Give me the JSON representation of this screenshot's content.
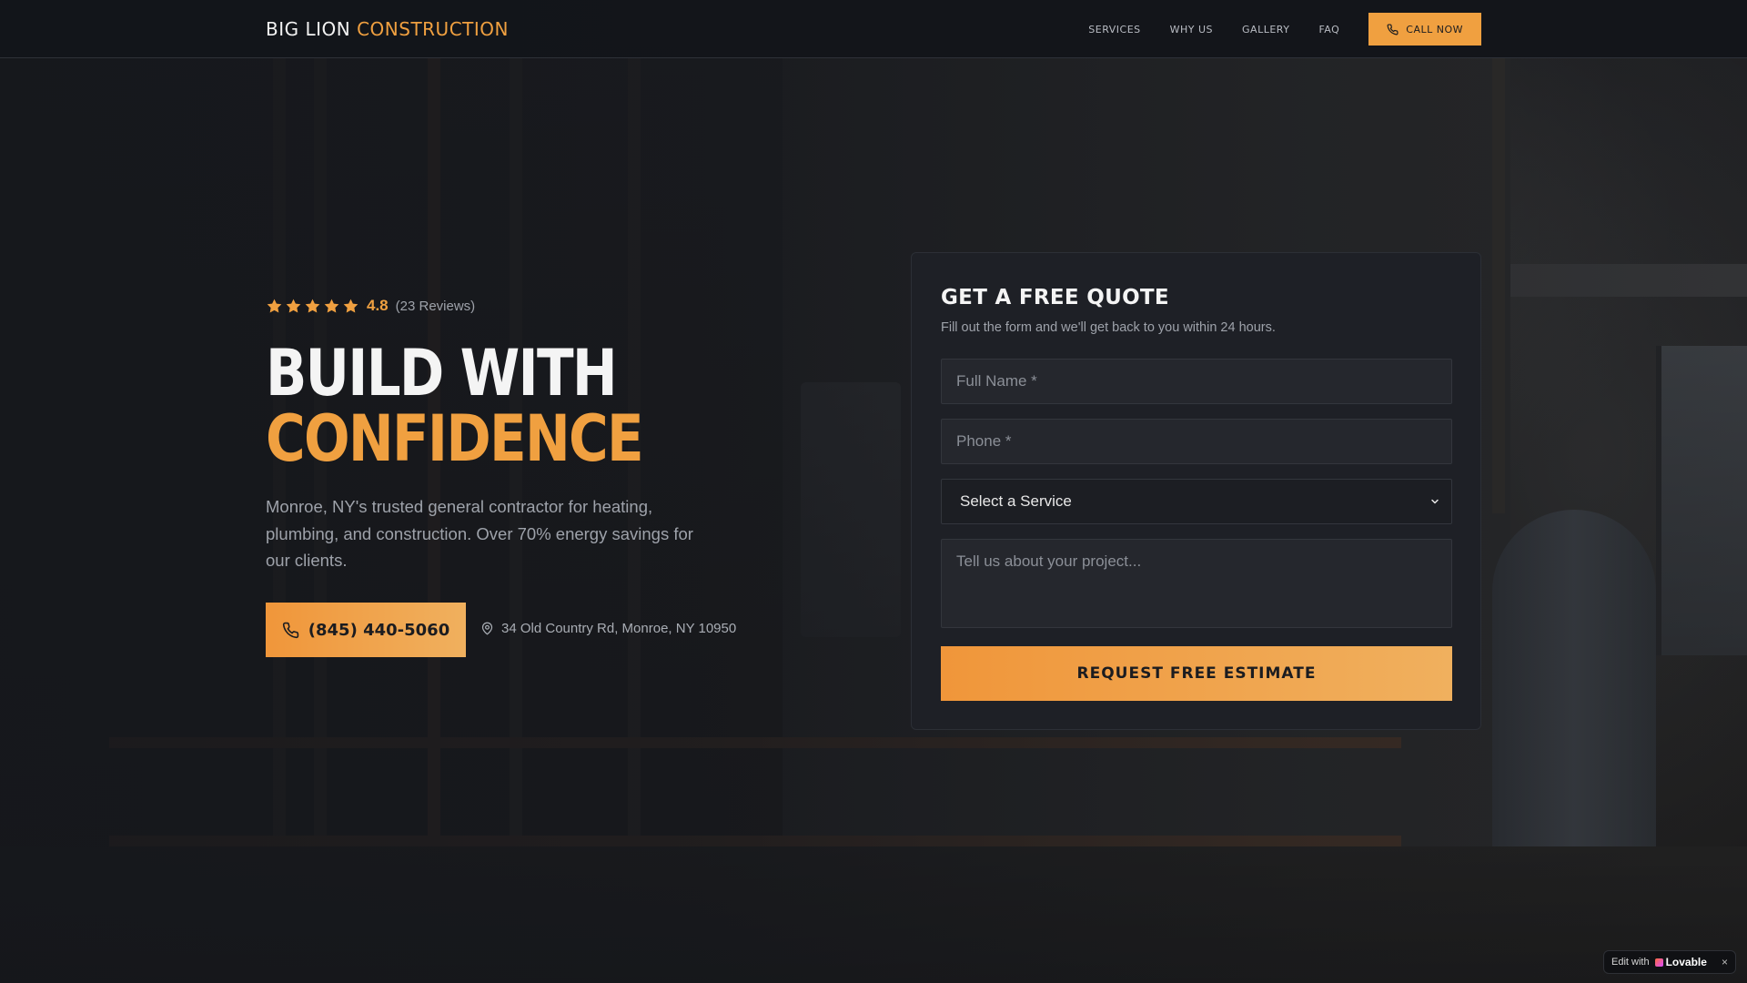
{
  "brand": {
    "name_part1": "BIG LION",
    "name_part2": "CONSTRUCTION"
  },
  "nav": {
    "links": [
      "SERVICES",
      "WHY US",
      "GALLERY",
      "FAQ"
    ],
    "call_label": "CALL NOW"
  },
  "hero": {
    "rating": {
      "value": "4.8",
      "count": "(23 Reviews)",
      "stars": 5
    },
    "title_line1": "BUILD WITH",
    "title_line2": "CONFIDENCE",
    "description": "Monroe, NY's trusted general contractor for heating, plumbing, and construction. Over 70% energy savings for our clients.",
    "phone": "(845) 440-5060",
    "address": "34 Old Country Rd, Monroe, NY 10950"
  },
  "quote_form": {
    "title": "GET A FREE QUOTE",
    "subtitle": "Fill out the form and we'll get back to you within 24 hours.",
    "name_placeholder": "Full Name *",
    "phone_placeholder": "Phone *",
    "service_selected": "Select a Service",
    "message_placeholder": "Tell us about your project...",
    "submit_label": "REQUEST FREE ESTIMATE"
  },
  "badge": {
    "prefix": "Edit with",
    "brand": "Lovable",
    "close": "×"
  },
  "colors": {
    "accent": "#f0a040",
    "background": "#15171c",
    "card": "#1e2026"
  }
}
